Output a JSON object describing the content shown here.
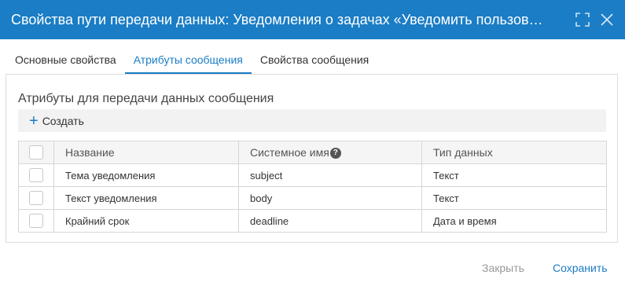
{
  "window": {
    "title": "Свойства пути передачи данных: Уведомления о задачах «Уведомить пользов…",
    "maximize_icon": "expand-icon",
    "close_icon": "close-icon"
  },
  "tabs": [
    {
      "label": "Основные свойства",
      "active": false
    },
    {
      "label": "Атрибуты сообщения",
      "active": true
    },
    {
      "label": "Свойства сообщения",
      "active": false
    }
  ],
  "section": {
    "title": "Атрибуты для передачи данных сообщения",
    "create_label": "Создать"
  },
  "table": {
    "columns": [
      "Название",
      "Системное имя",
      "Тип данных"
    ],
    "rows": [
      {
        "name": "Тема уведомления",
        "system_name": "subject",
        "type": "Текст"
      },
      {
        "name": "Текст уведомления",
        "system_name": "body",
        "type": "Текст"
      },
      {
        "name": "Крайний срок",
        "system_name": "deadline",
        "type": "Дата и время"
      }
    ]
  },
  "footer": {
    "close_label": "Закрыть",
    "save_label": "Сохранить"
  },
  "colors": {
    "accent": "#1a7dc5",
    "title_bar": "#1a7dc5",
    "disabled_text": "#999999"
  }
}
